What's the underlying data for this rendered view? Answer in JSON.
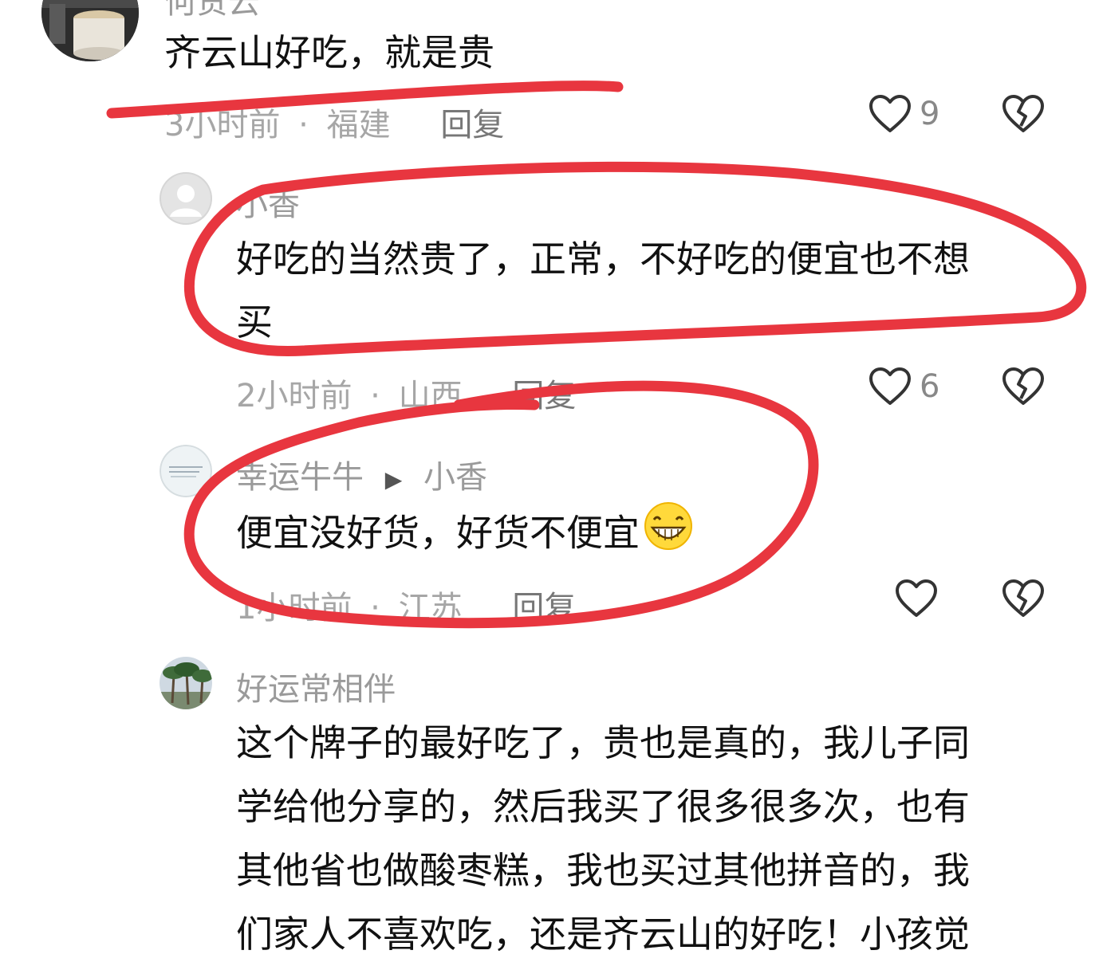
{
  "comments": [
    {
      "username": "何贵云",
      "text": "齐云山好吃，就是贵",
      "time": "3小时前",
      "location": "福建",
      "reply_label": "回复",
      "likes": "9",
      "avatar_icon": "coffee-cup-photo"
    },
    {
      "username": "小香",
      "text_line1": "好吃的当然贵了，正常，不好吃的便宜也不想",
      "text_line2": "买",
      "time": "2小时前",
      "location": "山西",
      "reply_label": "回复",
      "likes": "6",
      "avatar_icon": "default-user-icon"
    },
    {
      "username": "幸运牛牛",
      "reply_to": "小香",
      "text": "便宜没好货，好货不便宜",
      "emoji": "grinning-face-emoji",
      "time": "1小时前",
      "location": "江苏",
      "reply_label": "回复",
      "likes": "",
      "avatar_icon": "note-text-photo"
    },
    {
      "username": "好运常相伴",
      "text_line1": "这个牌子的最好吃了，贵也是真的，我儿子同",
      "text_line2": "学给他分享的，然后我买了很多很多次，也有",
      "text_line3": "其他省也做酸枣糕，我也买过其他拼音的，我",
      "text_line4": "们家人不喜欢吃，还是齐云山的好吃！小孩觉",
      "avatar_icon": "palm-trees-photo"
    }
  ],
  "separator": "·",
  "colors": {
    "annotation_red": "#e8363f",
    "text": "#111111",
    "meta": "#a6a6a6",
    "username": "#9a9a9a"
  }
}
